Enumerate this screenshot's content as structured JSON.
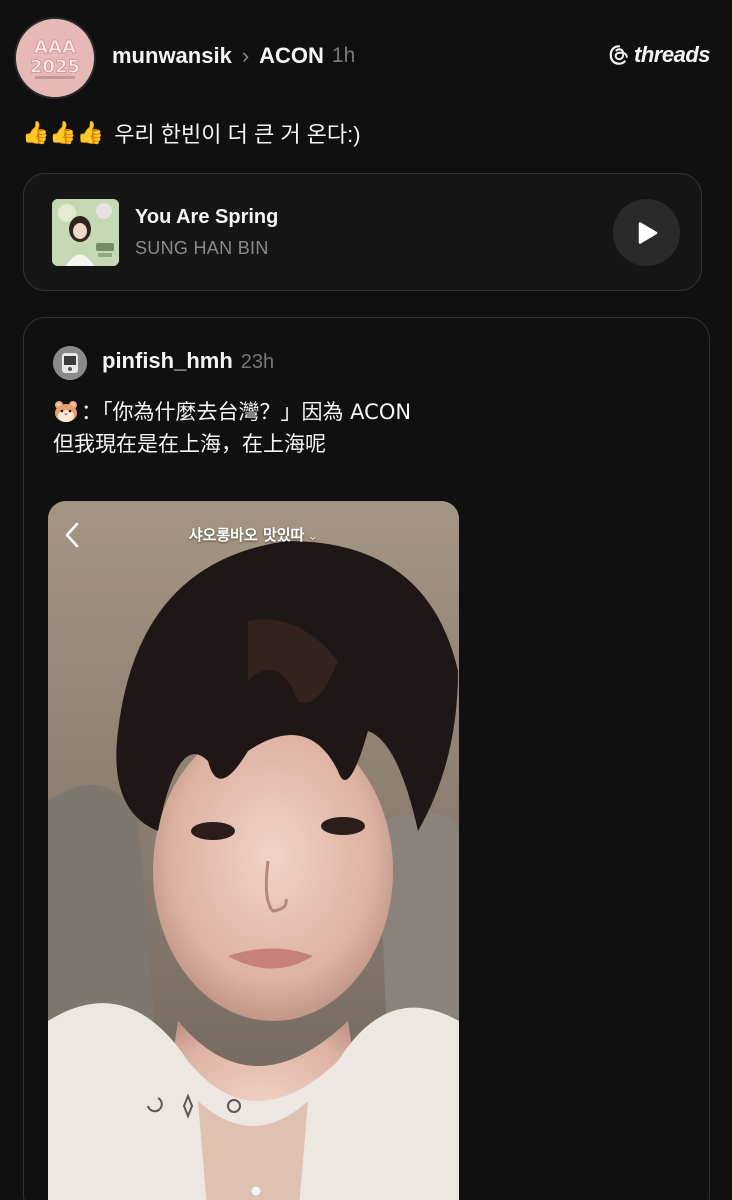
{
  "app": {
    "brand": "threads",
    "background": "#101010"
  },
  "post": {
    "avatar_text": "AAA 2025",
    "username": "munwansik",
    "separator": "›",
    "reply_target": "ACON",
    "time": "1h",
    "emoji": "👍👍👍",
    "text": "우리 한빈이 더 큰 거 온다:)"
  },
  "music": {
    "title": "You Are Spring",
    "artist": "SUNG HAN BIN"
  },
  "quote": {
    "username": "pinfish_hmh",
    "time": "23h",
    "line1": "：「你為什麼去台灣？」因為 ACON",
    "line2": "但我現在是在上海，在上海呢",
    "media_caption": "샤오롱바오 맛있따",
    "media_caption_chevron": "⌄"
  },
  "colors": {
    "text_primary": "#f3f5f7",
    "text_secondary": "#8a8a8a",
    "card_border": "#333333"
  }
}
